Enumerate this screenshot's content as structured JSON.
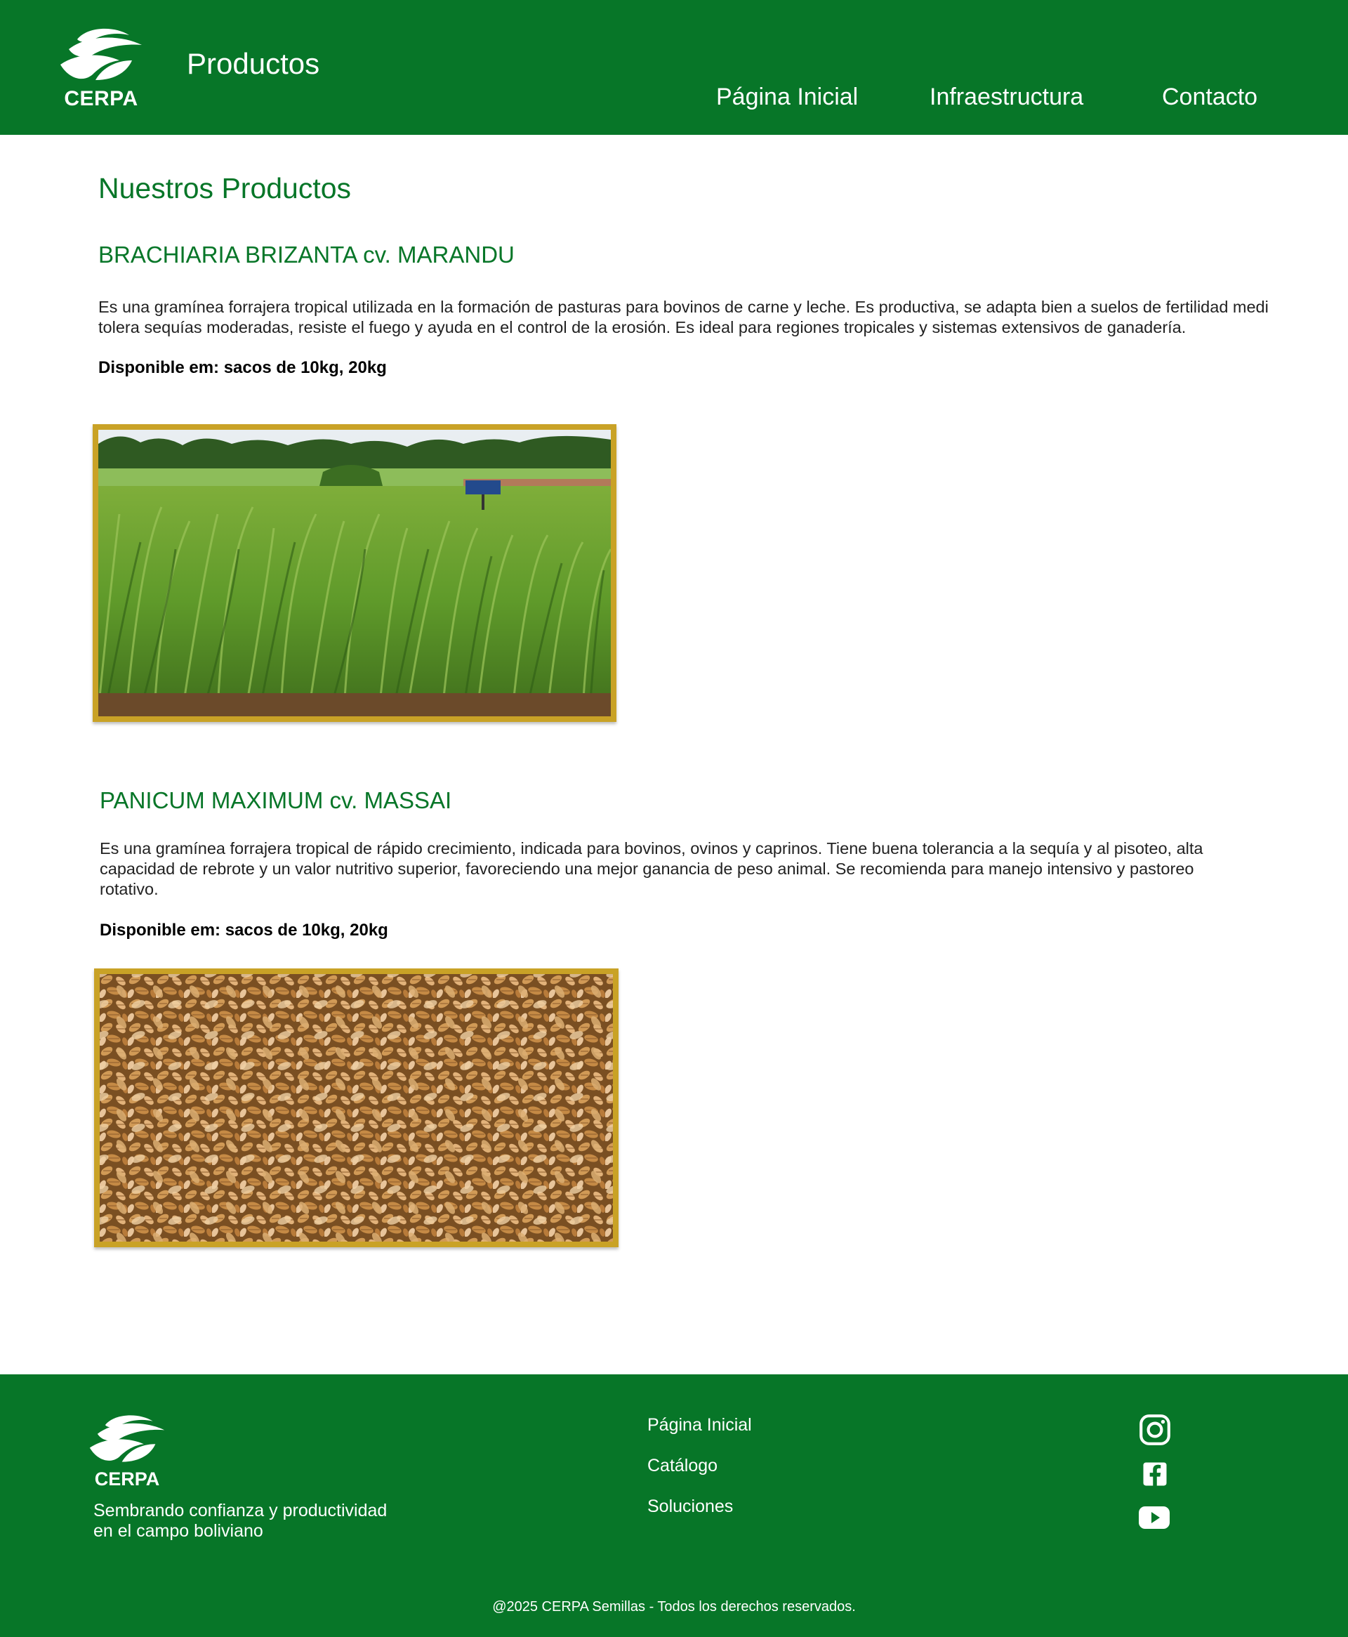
{
  "header": {
    "logo_text": "CERPA",
    "page_title": "Productos",
    "nav": [
      "Página Inicial",
      "Infraestructura",
      "Contacto"
    ]
  },
  "main": {
    "title": "Nuestros Productos",
    "products": [
      {
        "name": "BRACHIARIA BRIZANTA cv. MARANDU",
        "description_lines": [
          "Es una gramínea forrajera tropical utilizada en la formación de pasturas para bovinos de carne y leche. Es productiva, se adapta bien a suelos de fertilidad medi",
          "tolera sequías moderadas, resiste el fuego y ayuda en el control de la erosión. Es ideal para regiones tropicales y sistemas extensivos de ganadería."
        ],
        "availability": "Disponible em: sacos de 10kg, 20kg"
      },
      {
        "name": "PANICUM MAXIMUM cv. MASSAI",
        "description_lines": [
          "Es una gramínea forrajera tropical de rápido crecimiento, indicada para bovinos, ovinos y caprinos. Tiene buena tolerancia a la sequía y al pisoteo, alta",
          "capacidad de rebrote y un valor nutritivo superior, favoreciendo una mejor ganancia de peso animal. Se recomienda para manejo intensivo y pastoreo",
          "rotativo."
        ],
        "availability": "Disponible em: sacos de 10kg, 20kg"
      }
    ]
  },
  "footer": {
    "logo_text": "CERPA",
    "slogan_lines": [
      "Sembrando confianza y productividad",
      "en el campo boliviano"
    ],
    "links": [
      "Página Inicial",
      "Catálogo",
      "Soluciones"
    ],
    "social_icons": [
      "instagram-icon",
      "facebook-icon",
      "youtube-icon"
    ],
    "copyright": "@2025 CERPA Semillas - Todos los derechos reservados."
  },
  "colors": {
    "brand_green": "#077628",
    "frame_gold": "#c9a226",
    "white": "#ffffff"
  }
}
